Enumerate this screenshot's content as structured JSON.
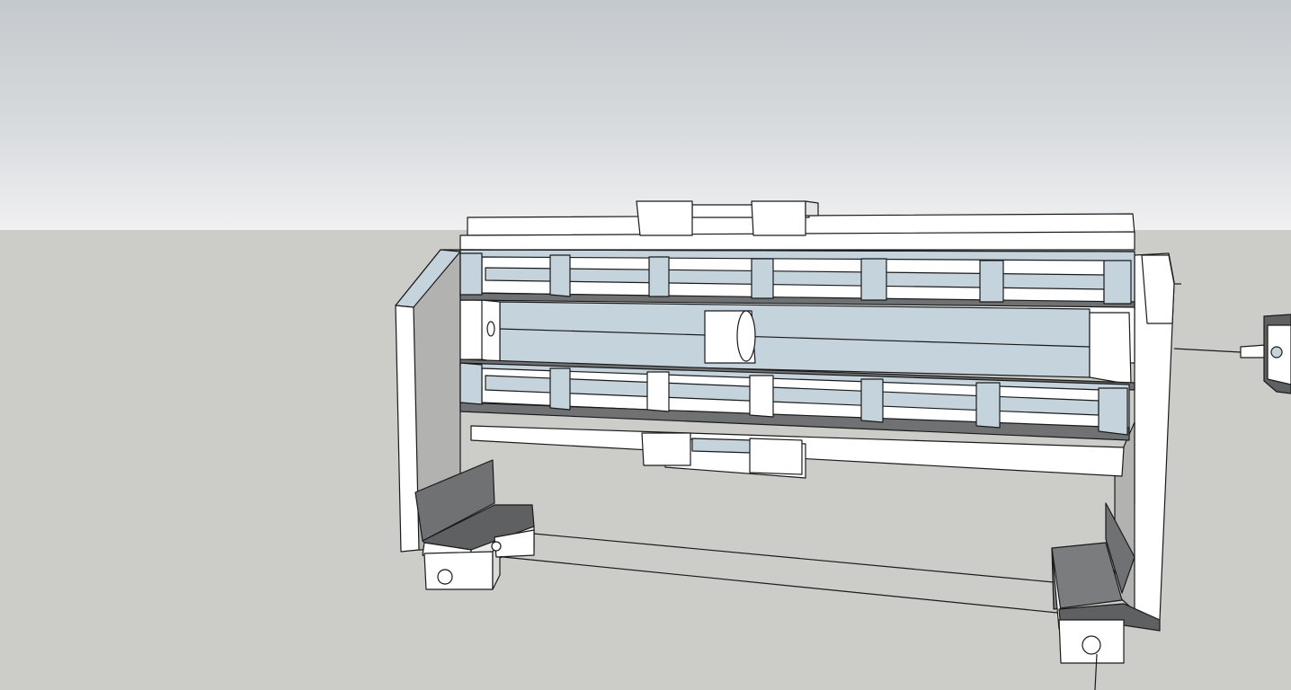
{
  "scene": {
    "sky_color": "#d7dbde",
    "ground_color": "#cccdc8",
    "frame_color": "#ffffff",
    "panel_color": "#c5d3dd",
    "shadow_panel_color": "#a7a8a6",
    "dark_face_color": "#6f7173",
    "edge_color": "#1a1a1a"
  }
}
